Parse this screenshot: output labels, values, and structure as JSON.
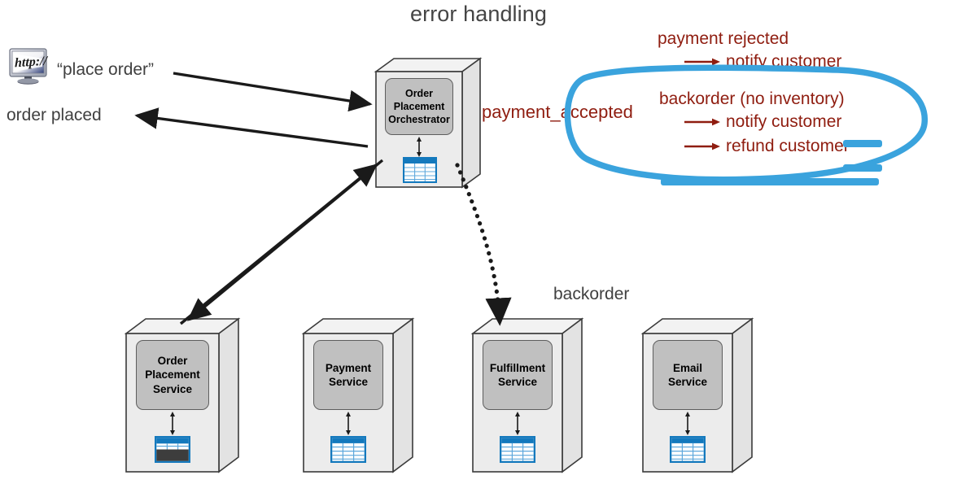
{
  "title": "error handling",
  "colors": {
    "annotation_red": "#8f1d10",
    "highlight_blue": "#3aa3dd",
    "db_blue": "#1479bd",
    "box_fill": "#ececec",
    "plate_fill": "#c0c0c0",
    "label_gray": "#404040"
  },
  "client": {
    "icon": "http-monitor-icon",
    "request_label": "“place order”",
    "response_label": "order placed"
  },
  "orchestrator": {
    "name": "order-placement-orchestrator",
    "lines": [
      "Order",
      "Placement",
      "Orchestrator"
    ],
    "db_icon": "database-table-icon"
  },
  "event_labels": {
    "payment_accepted": "payment_accepted",
    "backorder": "backorder"
  },
  "annotations": {
    "group1": {
      "heading": "payment rejected",
      "actions": [
        "notify customer"
      ]
    },
    "group2": {
      "heading": "backorder (no inventory)",
      "actions": [
        "notify customer",
        "refund customer"
      ]
    },
    "highlight": "blue-ellipse-highlight"
  },
  "services": [
    {
      "name": "order-placement-service",
      "lines": [
        "Order",
        "Placement",
        "Service"
      ],
      "db_icon": "database-table-icon-filled"
    },
    {
      "name": "payment-service",
      "lines": [
        "Payment",
        "Service"
      ],
      "db_icon": "database-table-icon"
    },
    {
      "name": "fulfillment-service",
      "lines": [
        "Fulfillment",
        "Service"
      ],
      "db_icon": "database-table-icon"
    },
    {
      "name": "email-service",
      "lines": [
        "Email",
        "Service"
      ],
      "db_icon": "database-table-icon"
    }
  ]
}
